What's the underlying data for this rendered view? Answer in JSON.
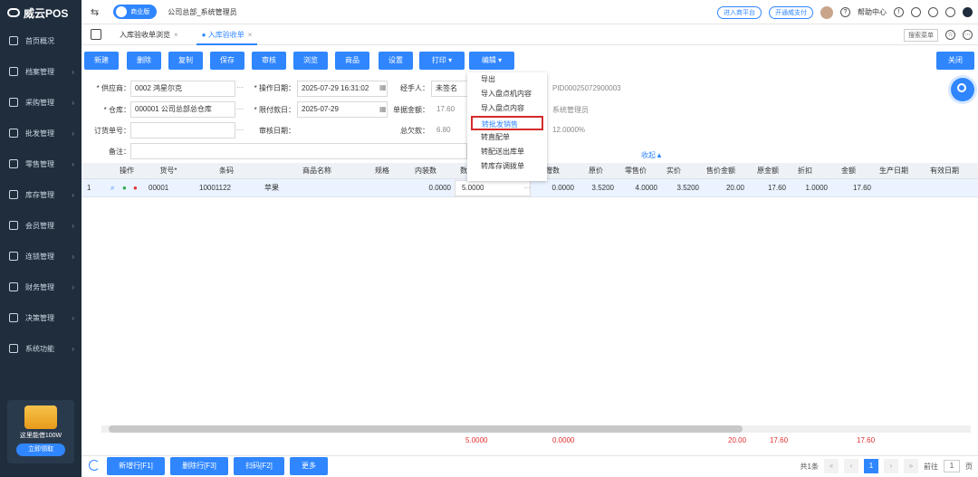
{
  "app": {
    "name": "威云POS"
  },
  "sidebar": {
    "items": [
      {
        "label": "首页概况"
      },
      {
        "label": "档案管理"
      },
      {
        "label": "采购管理"
      },
      {
        "label": "批发管理"
      },
      {
        "label": "零售管理"
      },
      {
        "label": "库存管理"
      },
      {
        "label": "会员管理"
      },
      {
        "label": "连锁管理"
      },
      {
        "label": "财务管理"
      },
      {
        "label": "决策管理"
      },
      {
        "label": "系统功能"
      }
    ],
    "promo_text": "这里能借100W",
    "promo_button": "立即领取"
  },
  "topbar": {
    "edition": "商业版",
    "company": "公司总部_系统管理员",
    "links": [
      "进入商平台",
      "开通威支付"
    ],
    "help": "帮助中心"
  },
  "tabs": {
    "items": [
      {
        "label": "入库验收单浏览"
      },
      {
        "label": "入库验收单"
      }
    ],
    "search_menu": "搜索菜单"
  },
  "toolbar": {
    "buttons": [
      "新建",
      "删除",
      "复制",
      "保存",
      "审核",
      "浏览",
      "商品",
      "设置",
      "打印",
      "编辑"
    ],
    "close": "关闭"
  },
  "form": {
    "supplier_label": "* 供应商：",
    "supplier_value": "0002 鸿星尔克",
    "op_date_label": "* 操作日期：",
    "op_date_value": "2025-07-29 16:31:02",
    "handler_label": "经手人：",
    "handler_value": "未签名",
    "doc_no": "PID00025072900003",
    "warehouse_label": "* 仓库：",
    "warehouse_value": "000001 公司总部总仓库",
    "due_label": "* 限付款日：",
    "due_value": "2025-07-29",
    "amount_label": "单据金额：",
    "amount_value": "17.60",
    "operator": "系统管理员",
    "order_label": "订货单号：",
    "audit_label": "审核日期：",
    "debt_label": "总欠款：",
    "debt_value": "6.80",
    "rate": "12.0000%",
    "remark_label": "备注：",
    "collapse": "收起▲"
  },
  "dropdown": {
    "items": [
      "导出",
      "导入盘点机内容",
      "导入盘点内容",
      "转批发销售",
      "转直配单",
      "转配送出库单",
      "转库存调拨单"
    ]
  },
  "grid": {
    "headers": [
      "操作",
      "货号*",
      "条码",
      "商品名称",
      "规格",
      "内装数",
      "数",
      "赠数",
      "原价",
      "零售价",
      "实价",
      "售价金额",
      "原金额",
      "折扣",
      "金额",
      "生产日期",
      "有效日期"
    ],
    "rows": [
      {
        "no": "1",
        "code": "00001",
        "barcode": "10001122",
        "name": "苹果",
        "pack": "0.0000",
        "qty": "5.0000",
        "gift": "0.0000",
        "orig_price": "3.5200",
        "retail": "4.0000",
        "actual": "3.5200",
        "sale_amt": "20.00",
        "orig_amt": "17.60",
        "discount": "1.0000",
        "amount": "17.60"
      }
    ],
    "totals": {
      "qty": "5.0000",
      "gift": "0.0000",
      "sale_amt": "20.00",
      "orig_amt": "17.60",
      "amount": "17.60"
    }
  },
  "footer": {
    "buttons": [
      "新增行[F1]",
      "删除行[F3]",
      "扫码[F2]",
      "更多"
    ],
    "total_text": "共1条",
    "page": "1",
    "goto_label": "前往",
    "goto_value": "1",
    "page_unit": "页"
  }
}
